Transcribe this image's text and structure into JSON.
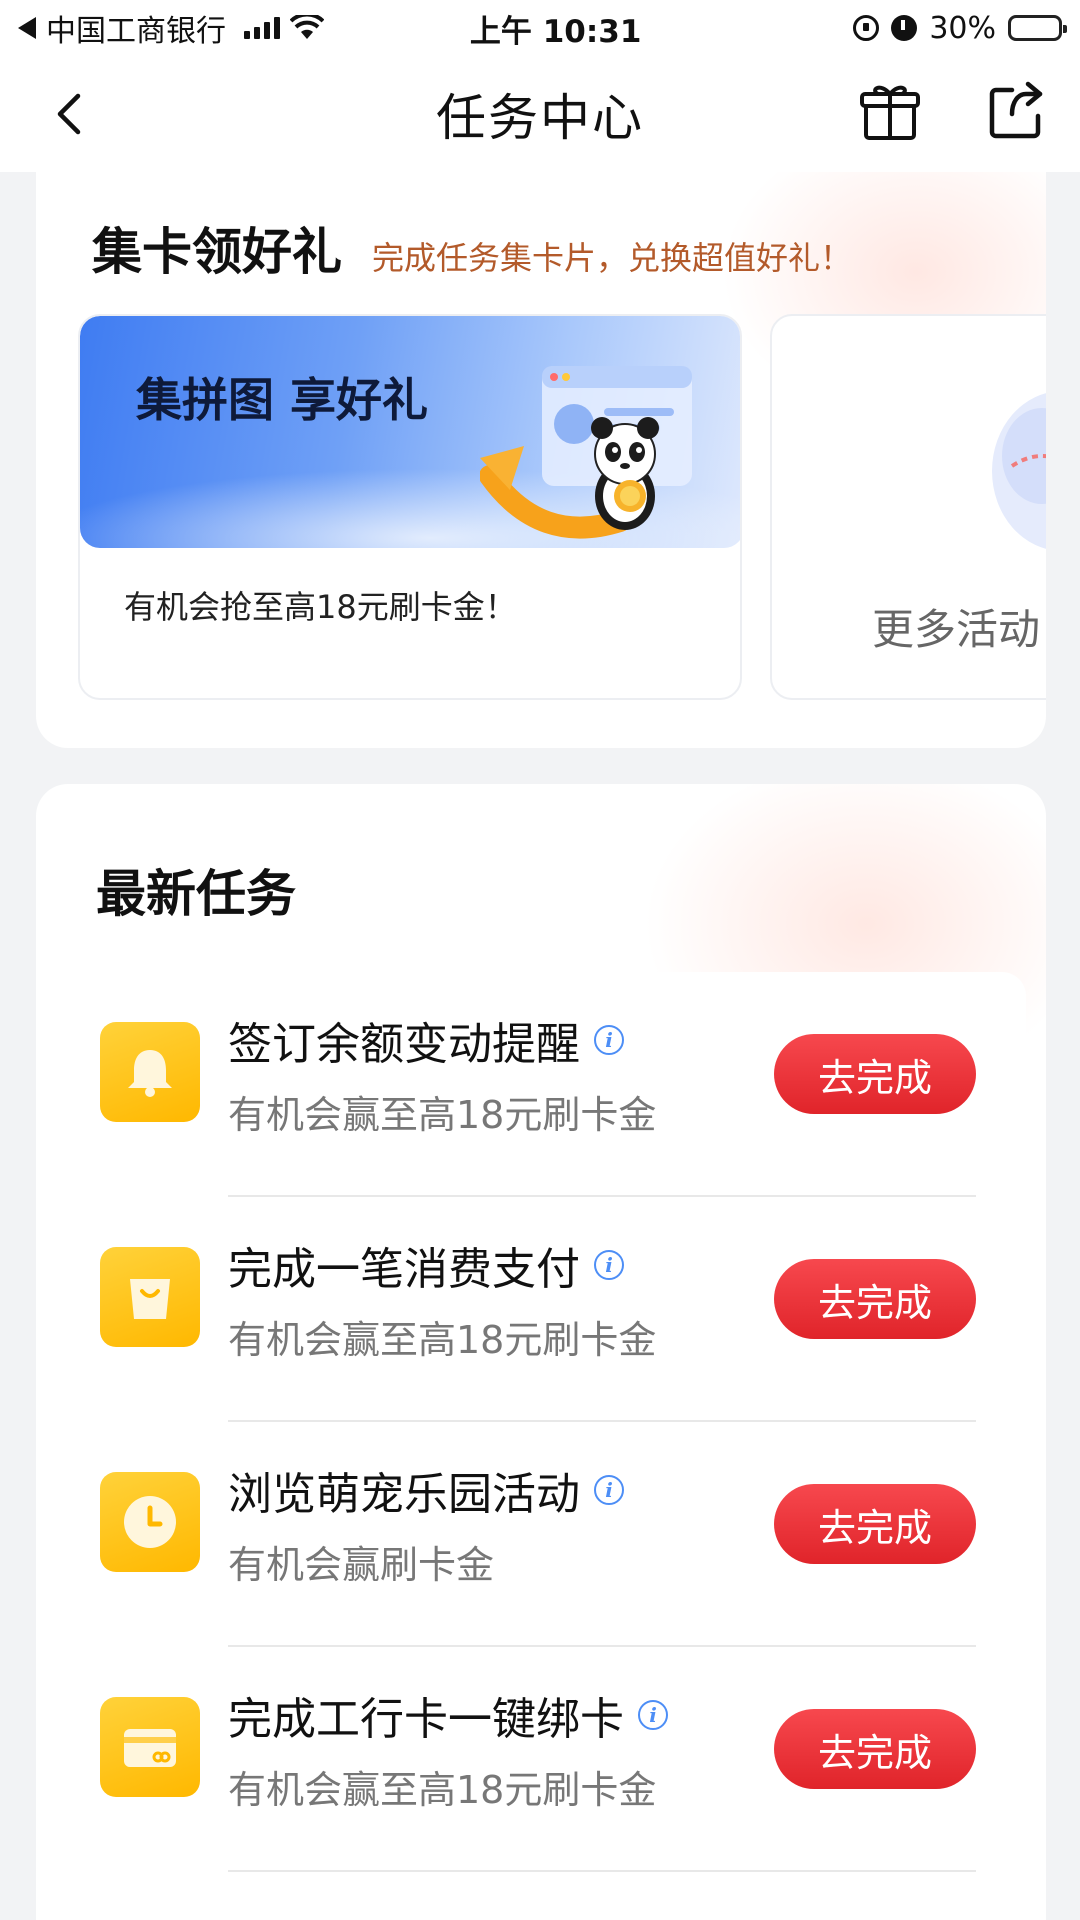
{
  "status_bar": {
    "carrier": "中国工商银行",
    "time": "上午 10:31",
    "battery": "30%",
    "battery_level": 0.3
  },
  "nav": {
    "title": "任务中心",
    "back_icon": "back-arrow-icon",
    "gift_icon": "gift-icon",
    "share_icon": "share-icon"
  },
  "card_section": {
    "title": "集卡领好礼",
    "subtitle": "完成任务集卡片，兑换超值好礼！",
    "promo": {
      "banner_title": "集拼图 享好礼",
      "description": "有机会抢至高18元刷卡金！"
    },
    "more": {
      "label": "更多活动"
    }
  },
  "tasks": {
    "title": "最新任务",
    "items": [
      {
        "name": "签订余额变动提醒",
        "desc": "有机会赢至高18元刷卡金",
        "button": "去完成",
        "icon": "bell-icon"
      },
      {
        "name": "完成一笔消费支付",
        "desc": "有机会赢至高18元刷卡金",
        "button": "去完成",
        "icon": "shopping-bag-icon"
      },
      {
        "name": "浏览萌宠乐园活动",
        "desc": "有机会赢刷卡金",
        "button": "去完成",
        "icon": "clock-icon"
      },
      {
        "name": "完成工行卡一键绑卡",
        "desc": "有机会赢至高18元刷卡金",
        "button": "去完成",
        "icon": "bank-card-icon"
      }
    ]
  },
  "colors": {
    "accent_red": "#e8343a",
    "icon_yellow": "#ffc21a",
    "subtitle_brown": "#b35a2a",
    "info_blue": "#4d8ef6"
  }
}
